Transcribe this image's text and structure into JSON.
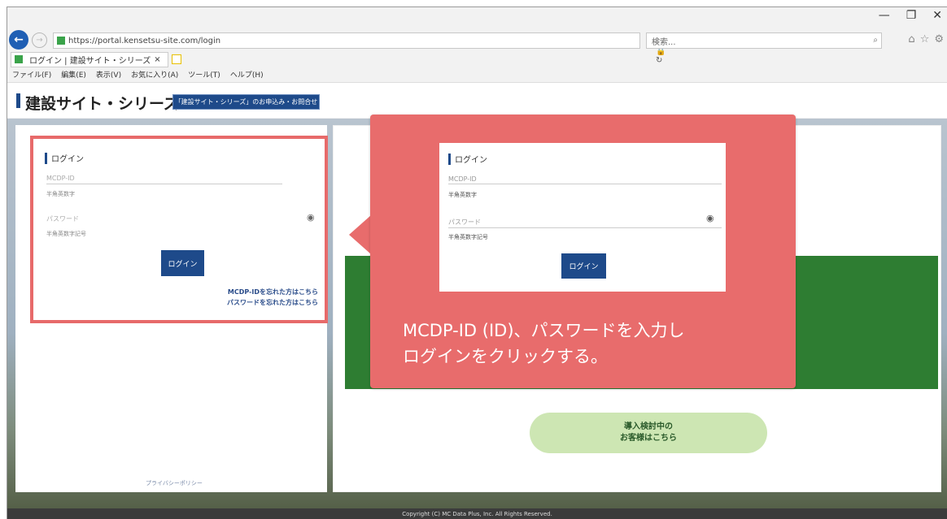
{
  "browser": {
    "url": "https://portal.kensetsu-site.com/login",
    "search_placeholder": "検索...",
    "tab_title": "ログイン | 建設サイト・シリーズ",
    "menu": [
      "ファイル(F)",
      "編集(E)",
      "表示(V)",
      "お気に入り(A)",
      "ツール(T)",
      "ヘルプ(H)"
    ]
  },
  "site": {
    "title": "建設サイト・シリーズ",
    "inquiry_button": "「建設サイト・シリーズ」のお申込み・お問合せ"
  },
  "login_form": {
    "heading": "ログイン",
    "id_placeholder": "MCDP-ID",
    "id_hint": "半角英数字",
    "password_placeholder": "パスワード",
    "password_hint": "半角英数字記号",
    "login_button": "ログイン",
    "forgot_id": "MCDP-IDを忘れた方はこちら",
    "forgot_password": "パスワードを忘れた方はこちら"
  },
  "privacy_link": "プライバシーポリシー",
  "consider_button": {
    "line1": "導入検討中の",
    "line2": "お客様はこちら"
  },
  "copyright": "Copyright (C) MC Data Plus, Inc. All Rights Reserved.",
  "callout": {
    "line1": "MCDP-ID (ID)、パスワードを入力し",
    "line2": "ログインをクリックする。"
  }
}
